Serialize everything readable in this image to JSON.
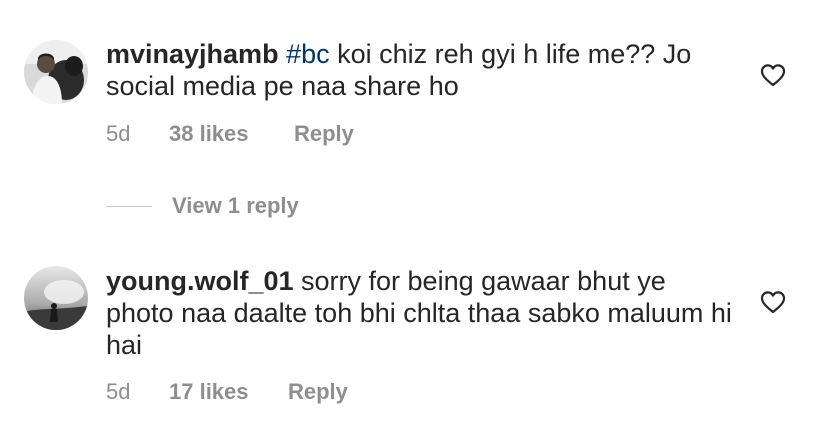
{
  "comments": [
    {
      "username": "mvinayjhamb",
      "hashtag": "#bc",
      "text": " koi chiz reh gyi h life me?? Jo social media pe naa share ho",
      "age": "5d",
      "likes": "38 likes",
      "reply_label": "Reply",
      "avatar_icon": "profile-photo-man-with-dog",
      "like_icon": "heart-outline-icon"
    },
    {
      "username": "young.wolf_01",
      "text": " sorry for being gawaar bhut ye photo naa daalte toh bhi chlta thaa sabko maluum hi hai",
      "age": "5d",
      "likes": "17 likes",
      "reply_label": "Reply",
      "avatar_icon": "profile-photo-silhouette-sky",
      "like_icon": "heart-outline-icon"
    }
  ],
  "view_replies": {
    "label": "View 1 reply"
  },
  "colors": {
    "text": "#262626",
    "secondary": "#8e8e8e",
    "hashtag": "#00376b",
    "divider": "#c7c7c7"
  }
}
